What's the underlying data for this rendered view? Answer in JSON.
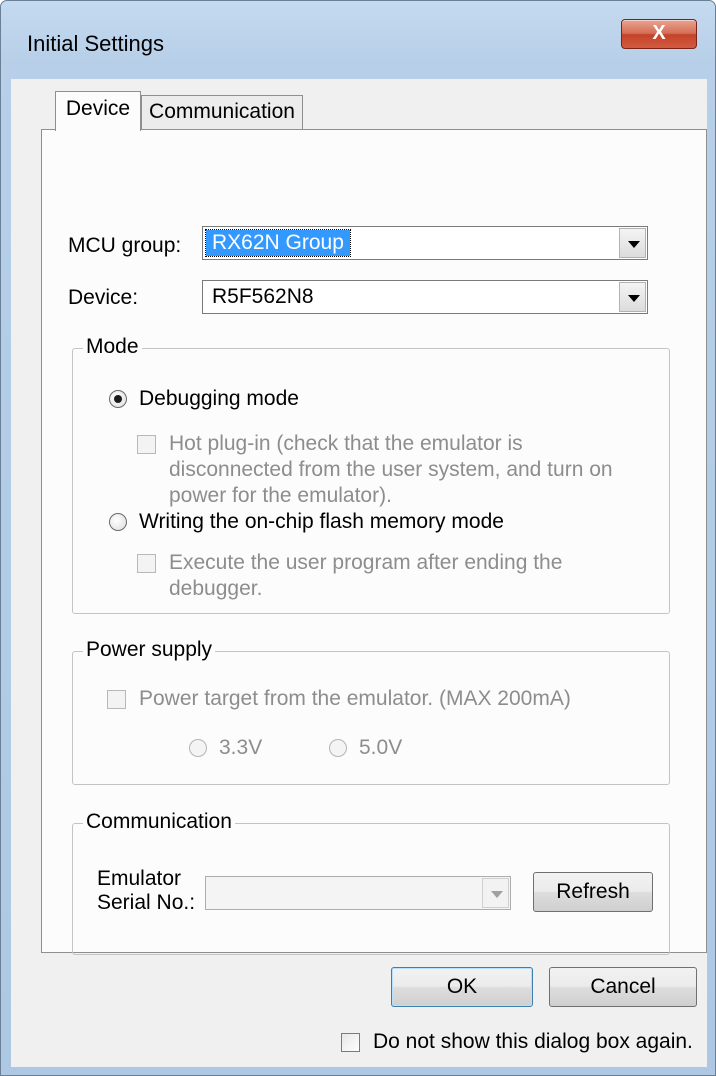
{
  "window": {
    "title": "Initial Settings",
    "close_glyph": "X"
  },
  "tabs": [
    {
      "label": "Device",
      "active": true
    },
    {
      "label": "Communication",
      "active": false
    }
  ],
  "device_tab": {
    "mcu_group_label": "MCU group:",
    "mcu_group_value": "RX62N Group",
    "device_label": "Device:",
    "device_value": "R5F562N8",
    "mode": {
      "title": "Mode",
      "debugging_label": "Debugging mode",
      "hot_plug_label": [
        "Hot plug-in (check that the emulator is",
        "disconnected from the user system, and turn on",
        "power for the emulator)."
      ],
      "writing_label": "Writing the on-chip flash memory mode",
      "execute_label": [
        "Execute the user program after ending the",
        "debugger."
      ]
    },
    "power": {
      "title": "Power supply",
      "power_target_label": "Power target from the emulator. (MAX 200mA)",
      "v33_label": "3.3V",
      "v50_label": "5.0V"
    },
    "communication": {
      "title": "Communication",
      "serial_label_line1": "Emulator",
      "serial_label_line2": "Serial No.:",
      "serial_value": "",
      "refresh_label": "Refresh"
    }
  },
  "footer": {
    "ok_label": "OK",
    "cancel_label": "Cancel",
    "dont_show_label": "Do not show this dialog box again."
  }
}
